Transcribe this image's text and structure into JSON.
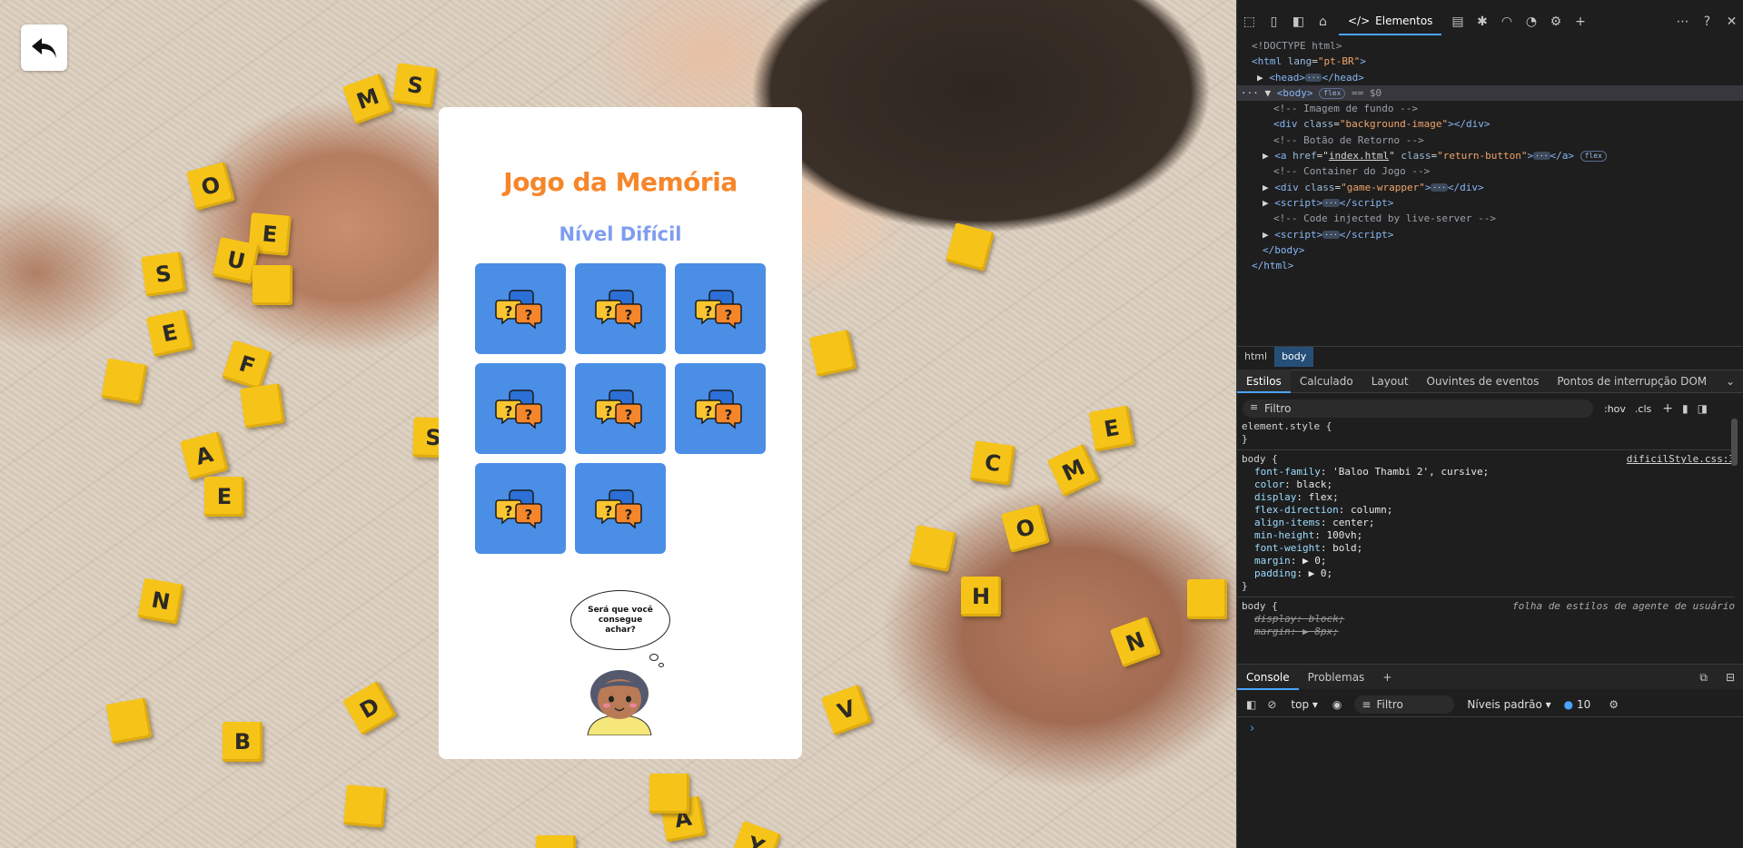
{
  "game": {
    "return_label": "",
    "title": "Jogo da Memória",
    "level": "Nível Difícil",
    "cards": [
      "card",
      "card",
      "card",
      "card",
      "card",
      "card",
      "card",
      "card"
    ],
    "speech": "Será que você consegue achar?"
  },
  "background_tiles": [
    "M",
    "S",
    "O",
    "E",
    "U",
    "E",
    "F",
    "S",
    "A",
    "N",
    "D",
    "B",
    "Y",
    "V",
    "A",
    "E",
    "C",
    "M",
    "O",
    "H",
    "N",
    "E",
    "S"
  ],
  "devtools": {
    "toolbar": {
      "elements_tab": "Elementos"
    },
    "dom": {
      "doctype": "<!DOCTYPE html>",
      "html_open_tag": "html",
      "html_lang_attr": "lang",
      "html_lang_val": "\"pt-BR\"",
      "head_tag": "head",
      "body_tag": "body",
      "body_badge": "flex",
      "body_eq": "== $0",
      "c_bg": "<!-- Imagem de fundo -->",
      "div_tag": "div",
      "class_attr": "class",
      "bg_class": "\"background-image\"",
      "c_return": "<!-- Botão de Retorno -->",
      "a_tag": "a",
      "href_attr": "href",
      "href_val": "index.html",
      "ret_class": "\"return-button\"",
      "a_badge": "flex",
      "c_container": "<!-- Container do Jogo -->",
      "gw_class": "\"game-wrapper\"",
      "script_tag": "script",
      "c_live": "<!-- Code injected by live-server -->",
      "body_close": "</body>",
      "html_close": "</html>"
    },
    "breadcrumb": [
      "html",
      "body"
    ],
    "styles_tabs": [
      "Estilos",
      "Calculado",
      "Layout",
      "Ouvintes de eventos",
      "Pontos de interrupção DOM"
    ],
    "filter_placeholder": "Filtro",
    "hov": ":hov",
    "cls": ".cls",
    "css": {
      "element_style": "element.style {",
      "close": "}",
      "body_sel": "body {",
      "source": "dificilStyle.css:3",
      "props": [
        {
          "p": "font-family",
          "v": "'Baloo Thambi 2', cursive;"
        },
        {
          "p": "color",
          "v": "black;"
        },
        {
          "p": "display",
          "v": "flex;"
        },
        {
          "p": "flex-direction",
          "v": "column;"
        },
        {
          "p": "align-items",
          "v": "center;"
        },
        {
          "p": "min-height",
          "v": "100vh;"
        },
        {
          "p": "font-weight",
          "v": "bold;"
        },
        {
          "p": "margin",
          "v": "▶ 0;"
        },
        {
          "p": "padding",
          "v": "▶ 0;"
        }
      ],
      "ua_sel": "body {",
      "ua_source": "folha de estilos de agente de usuário",
      "ua_props": [
        {
          "p": "display",
          "v": "block;"
        },
        {
          "p": "margin",
          "v": "▶ 8px;"
        }
      ]
    },
    "console_tabs": [
      "Console",
      "Problemas"
    ],
    "console_toolbar": {
      "context": "top",
      "filter": "Filtro",
      "levels": "Níveis padrão",
      "count": "10"
    },
    "prompt": "›"
  },
  "colors": {
    "title_orange": "#f6862a",
    "level_blue": "#7e9df0",
    "card_blue": "#4a8ee6",
    "tile_yellow": "#f6c418",
    "devtools_accent": "#4aa3ff"
  }
}
